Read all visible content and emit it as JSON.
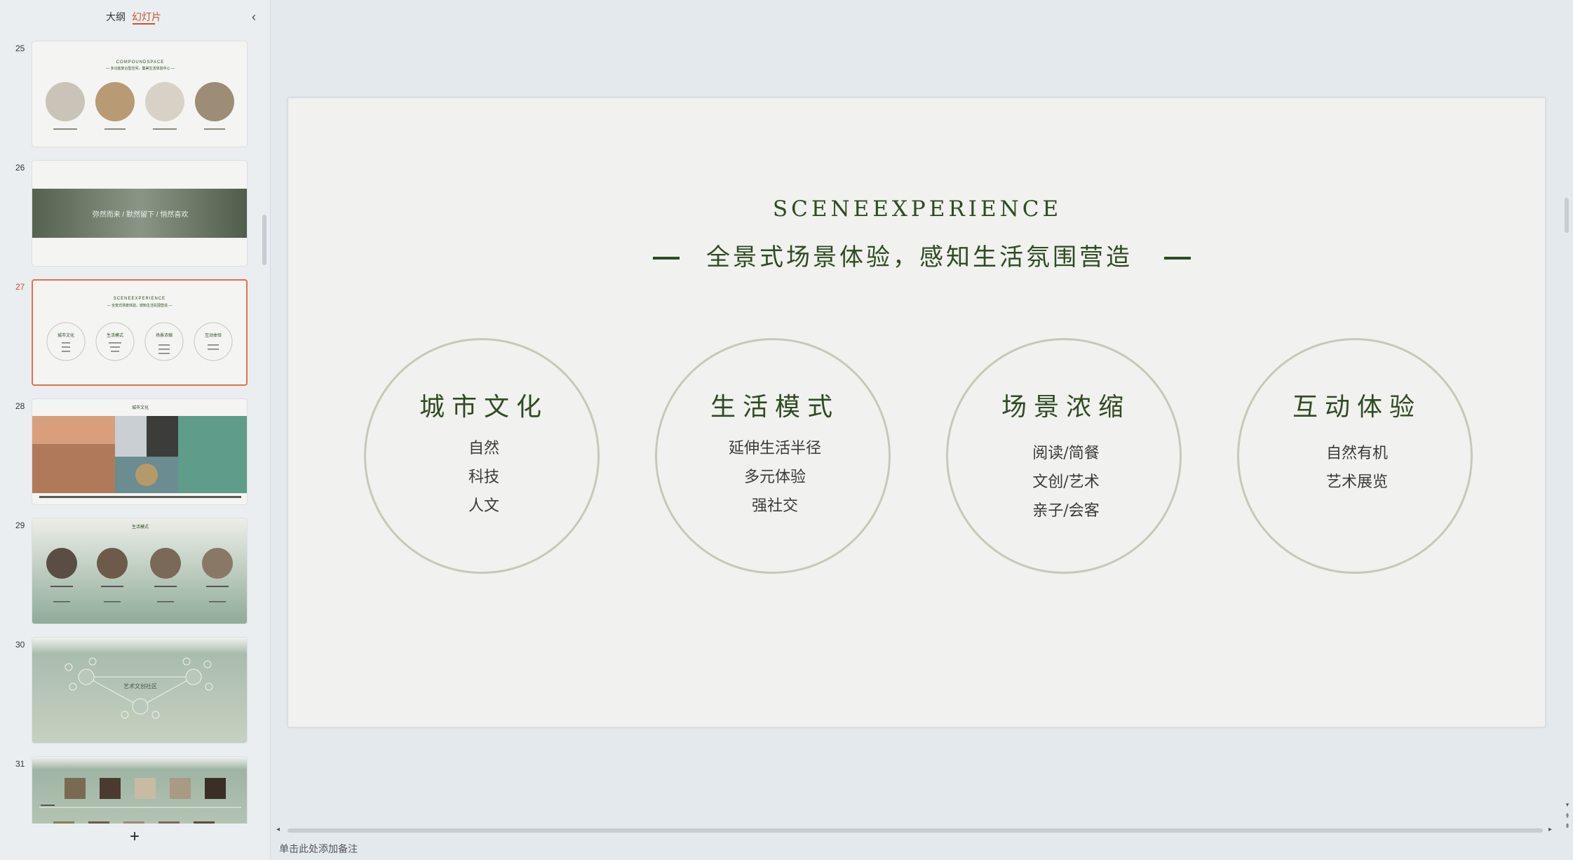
{
  "panel": {
    "tab_outline": "大纲",
    "tab_slides": "幻灯片",
    "collapse_icon": "‹",
    "add_icon": "+"
  },
  "thumbnails": [
    {
      "number": "25",
      "title": "COMPOUNDSPACE",
      "subtitle": "— 多功能复合型空间，集美生活体验中心 —"
    },
    {
      "number": "26",
      "caption": "弥然而来 / 默然留下 / 悄然喜欢"
    },
    {
      "number": "27",
      "title": "SCENEEXPERIENCE",
      "subtitle": "— 全景式场景体验，感知生活氛围营造 —",
      "labels": [
        "城市文化",
        "生活模式",
        "场景浓缩",
        "互动体验"
      ]
    },
    {
      "number": "28",
      "title": "城市文化"
    },
    {
      "number": "29",
      "title": "生活模式"
    },
    {
      "number": "30",
      "center_label": "艺术文创社区"
    },
    {
      "number": "31"
    }
  ],
  "slide": {
    "en_title": "SCENEEXPERIENCE",
    "cn_title": "全景式场景体验，感知生活氛围营造",
    "circles": [
      {
        "title": "城市文化",
        "items": [
          "自然",
          "科技",
          "人文"
        ]
      },
      {
        "title": "生活模式",
        "items": [
          "延伸生活半径",
          "多元体验",
          "强社交"
        ]
      },
      {
        "title": "场景浓缩",
        "items": [
          "阅读/简餐",
          "文创/艺术",
          "亲子/会客"
        ]
      },
      {
        "title": "互动体验",
        "items": [
          "自然有机",
          "艺术展览"
        ]
      }
    ]
  },
  "notes": {
    "placeholder": "单击此处添加备注"
  },
  "colors": {
    "accent": "#c8552d",
    "slide_green": "#2f4b23",
    "circle_border": "#c8c8ba",
    "slide_bg": "#f1f1ef"
  }
}
